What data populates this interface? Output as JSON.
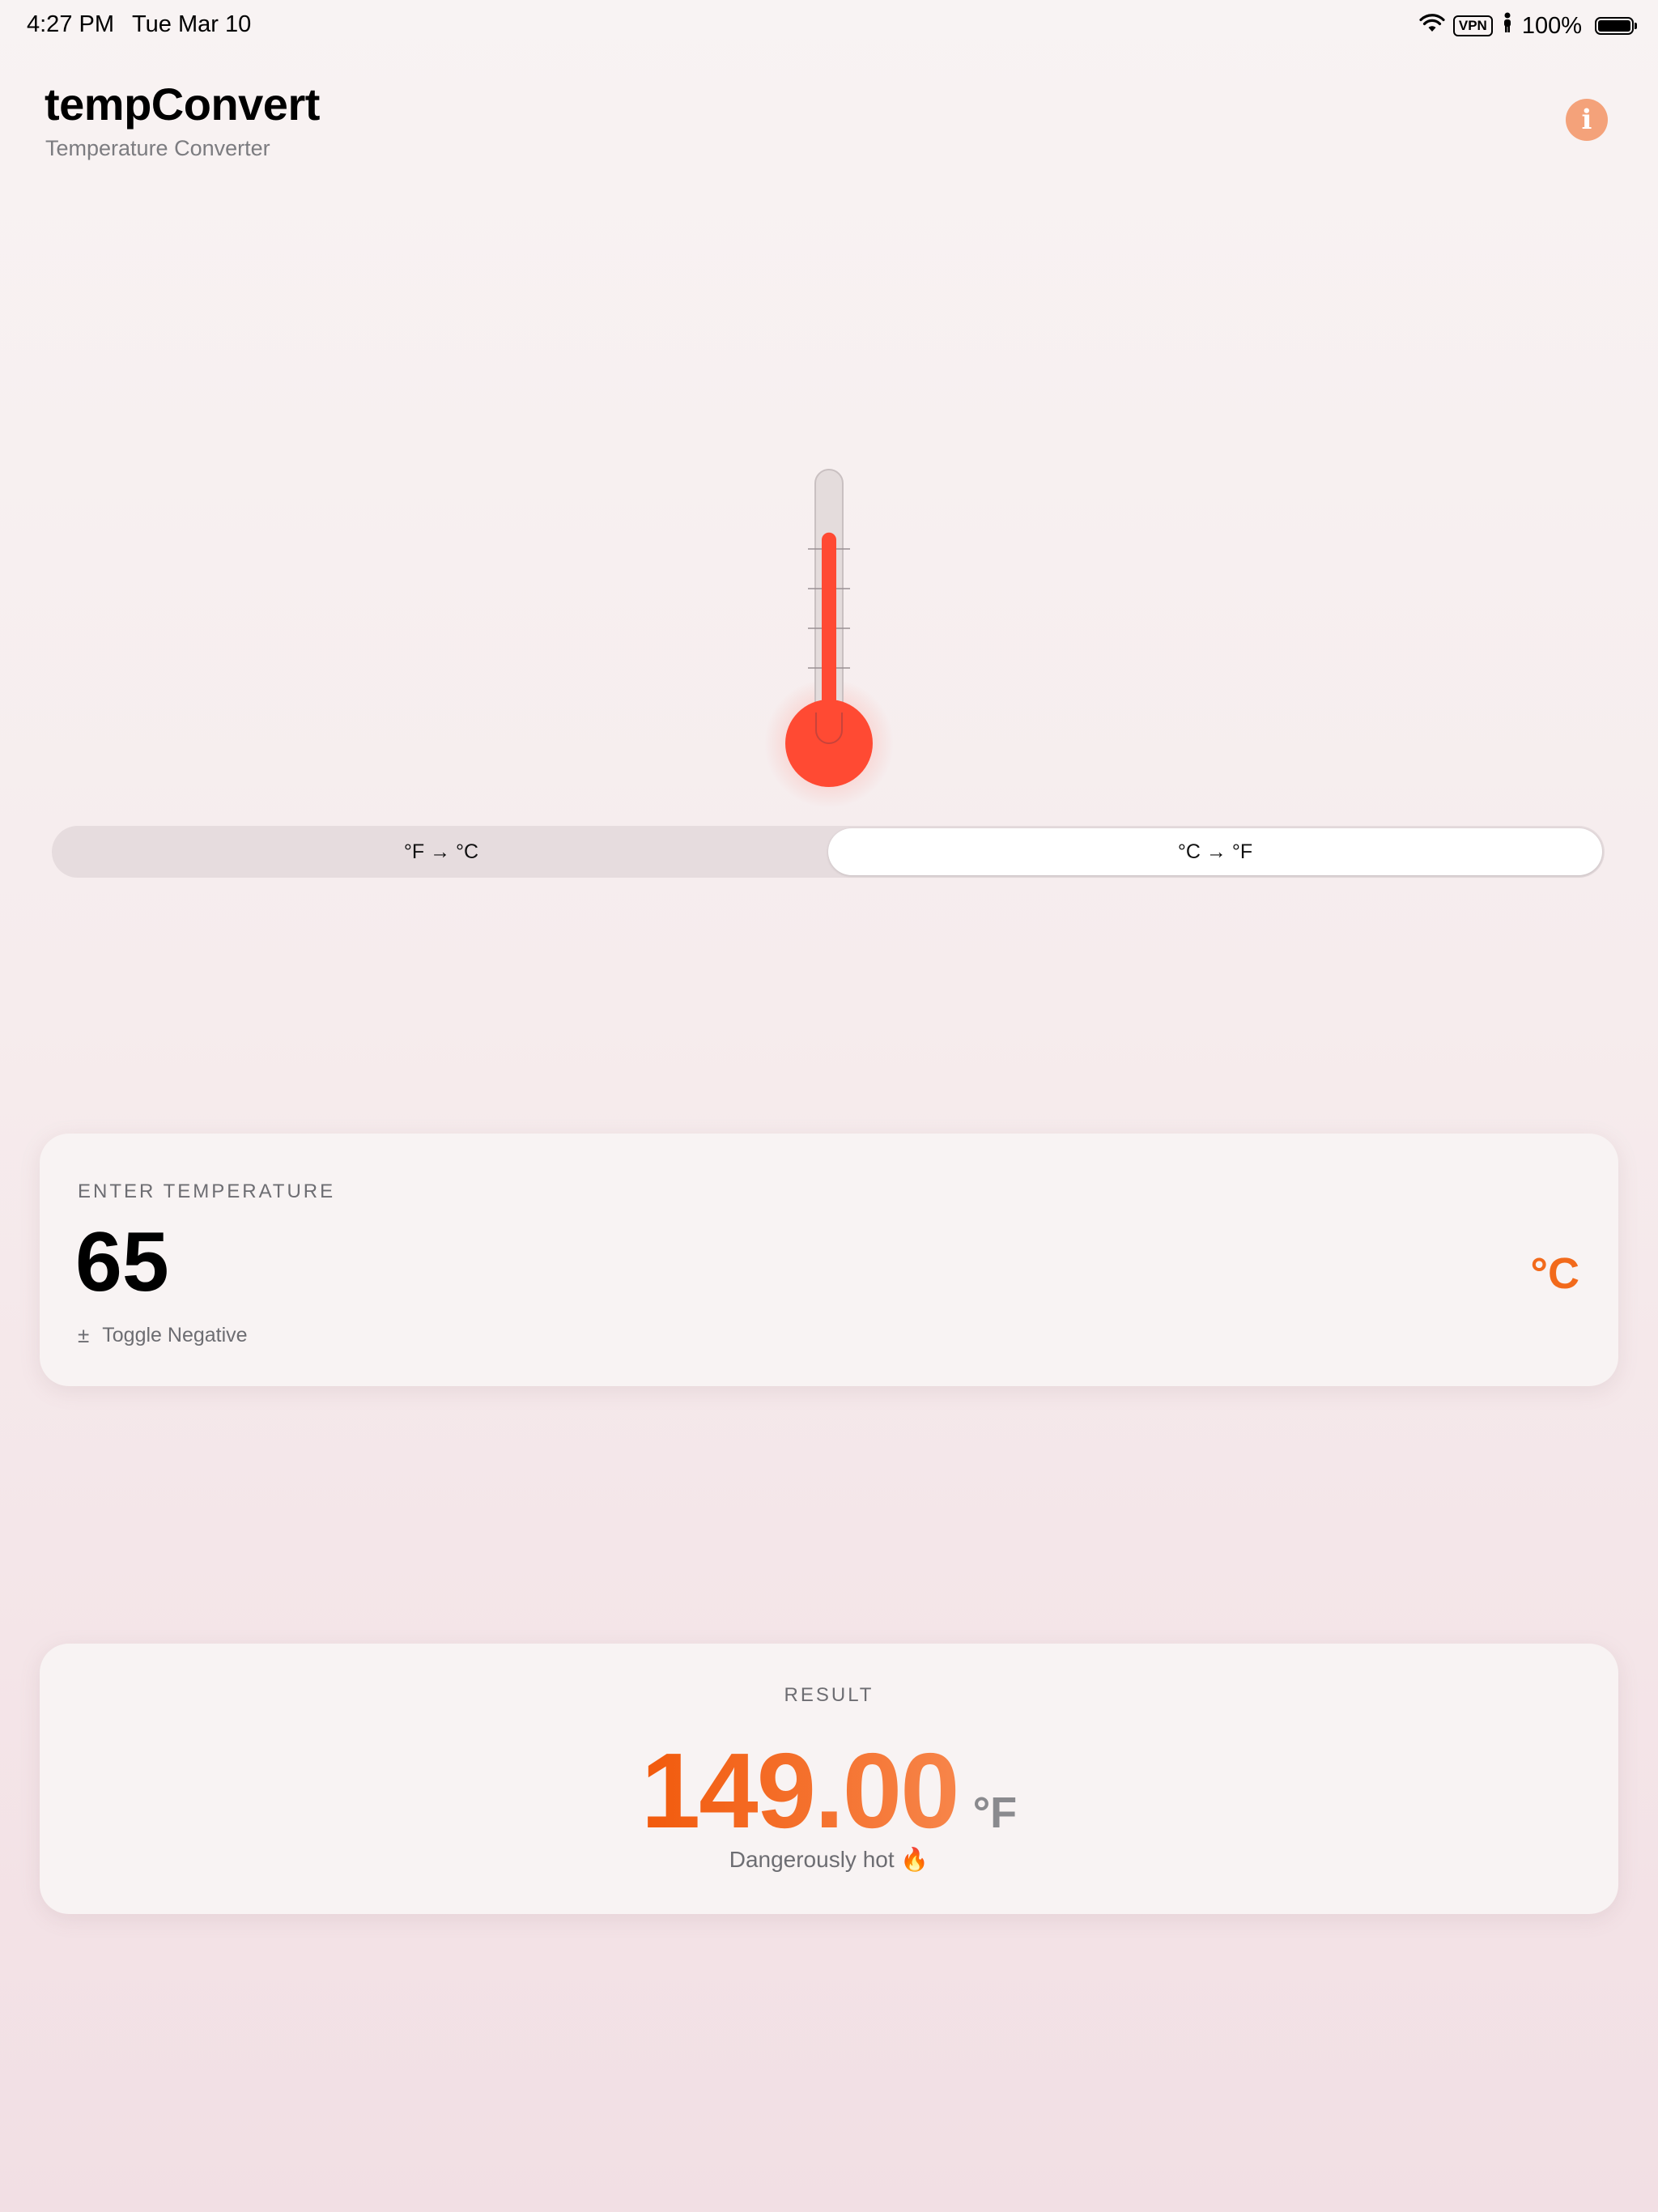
{
  "status_bar": {
    "time": "4:27 PM",
    "date": "Tue Mar 10",
    "vpn": "VPN",
    "battery": "100%",
    "icons": [
      "wifi-icon",
      "vpn-badge",
      "person-icon",
      "battery-icon"
    ]
  },
  "header": {
    "title": "tempConvert",
    "subtitle": "Temperature Converter",
    "info_icon": "info-icon"
  },
  "thermometer": {
    "level": 0.78,
    "color": "#ff4a33"
  },
  "mode_control": {
    "options": [
      "°F → °C",
      "°C → °F"
    ],
    "selected": 1
  },
  "input_card": {
    "label": "ENTER TEMPERATURE",
    "value": "65",
    "unit": "°C",
    "toggle_icon": "±",
    "toggle_label": "Toggle Negative"
  },
  "result_card": {
    "label": "RESULT",
    "value": "149.00",
    "unit": "°F",
    "description": "Dangerously hot 🔥"
  },
  "colors": {
    "accent": "#f26a1b",
    "info_button": "#f4a27a",
    "mercury": "#ff4a33"
  }
}
